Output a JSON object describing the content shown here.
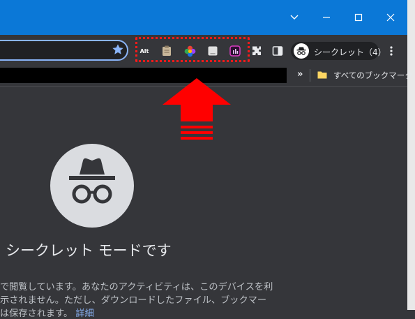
{
  "window_controls": {
    "dropdown": "chevron-down-icon",
    "minimize": "minimize-icon",
    "maximize": "maximize-icon",
    "close": "close-icon"
  },
  "toolbar": {
    "omnibox_text": "",
    "bookmark_star": "star-icon",
    "extensions": [
      {
        "name": "alt-text-extension",
        "glyph": "Alt"
      },
      {
        "name": "clipboard-extension",
        "glyph": ""
      },
      {
        "name": "color-picker-extension",
        "glyph": ""
      },
      {
        "name": "note-extension",
        "glyph": ""
      },
      {
        "name": "analytics-extension",
        "glyph": ""
      }
    ],
    "profile_label": "シークレット（4）"
  },
  "bookmarks": {
    "overflow": "»",
    "all_bookmarks_label": "すべてのブックマーク"
  },
  "page": {
    "heading": "シークレット モードです",
    "line1": "で閲覧しています。あなたのアクティビティは、このデバイスを利",
    "line2": "示されません。ただし、ダウンロードしたファイル、ブックマー",
    "line3": "は保存されます。",
    "link": "詳細"
  },
  "colors": {
    "titlebar": "#0b78d7",
    "background": "#35363a",
    "highlight": "#ff1a1a",
    "arrow": "#ff0000"
  }
}
